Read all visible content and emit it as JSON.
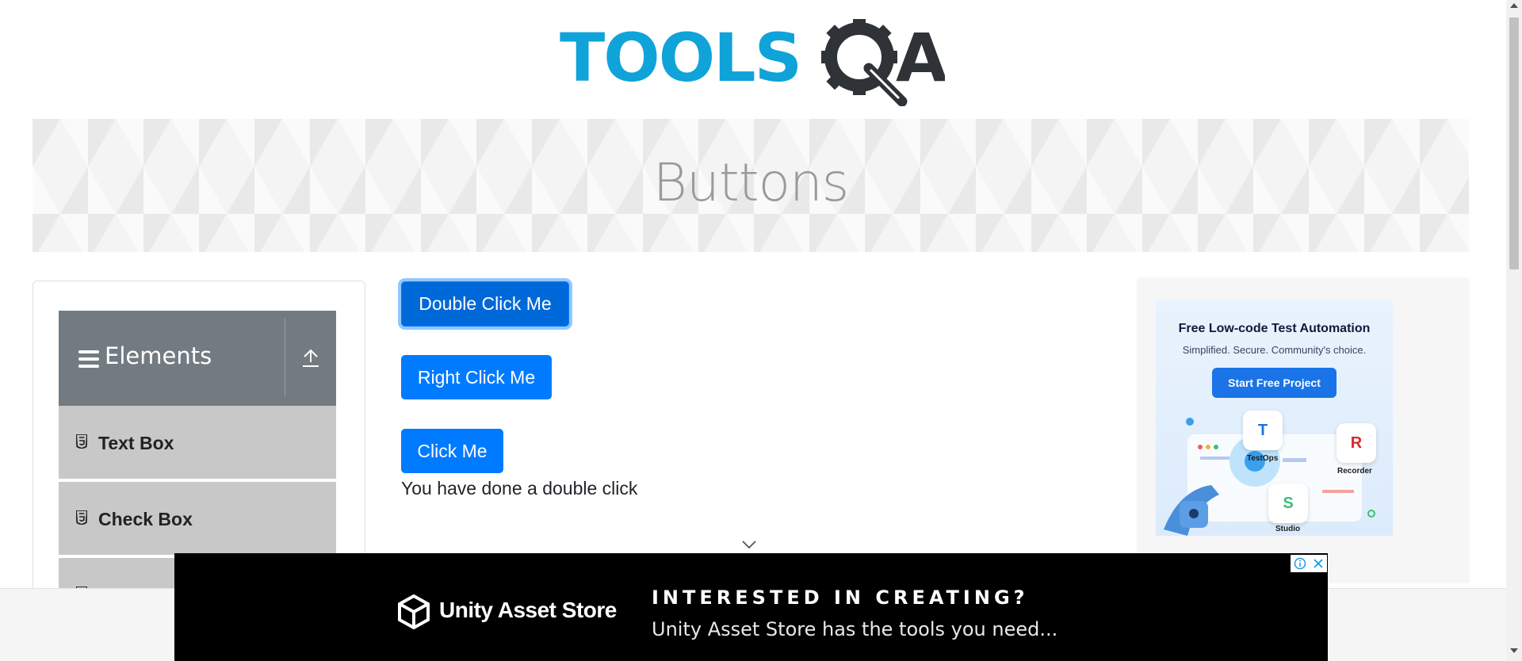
{
  "site": {
    "logo": {
      "brand_part1": "TOOLS",
      "brand_part2": "A",
      "icon": "gear-magnifier-icon",
      "colors": {
        "primary": "#0fa3d9",
        "dark": "#2f3337"
      }
    }
  },
  "banner": {
    "title": "Buttons"
  },
  "sidebar": {
    "group": {
      "label": "Elements",
      "menu_icon": "hamburger-icon",
      "collapse_icon": "upload-arrow-icon"
    },
    "items": [
      {
        "label": "Text Box",
        "icon": "html5-icon"
      },
      {
        "label": "Check Box",
        "icon": "html5-icon"
      }
    ]
  },
  "main": {
    "buttons": [
      {
        "label": "Double Click Me",
        "state": "focused"
      },
      {
        "label": "Right Click Me",
        "state": "default"
      },
      {
        "label": "Click Me",
        "state": "default"
      }
    ],
    "message": "You have done a double click",
    "accent_color": "#007bff"
  },
  "side_ad": {
    "title": "Free Low-code Test Automation",
    "subtitle": "Simplified. Secure. Community's choice.",
    "cta": "Start Free Project",
    "tiles": [
      {
        "label": "TestOps",
        "letter": "T"
      },
      {
        "label": "Recorder",
        "letter": "R"
      },
      {
        "label": "Studio",
        "letter": "S"
      }
    ]
  },
  "bottom_ad": {
    "brand": "Unity Asset Store",
    "headline": "INTERESTED IN CREATING?",
    "tagline": "Unity Asset Store has the tools you need...",
    "info_icon": "info-icon",
    "close_icon": "close-icon"
  }
}
